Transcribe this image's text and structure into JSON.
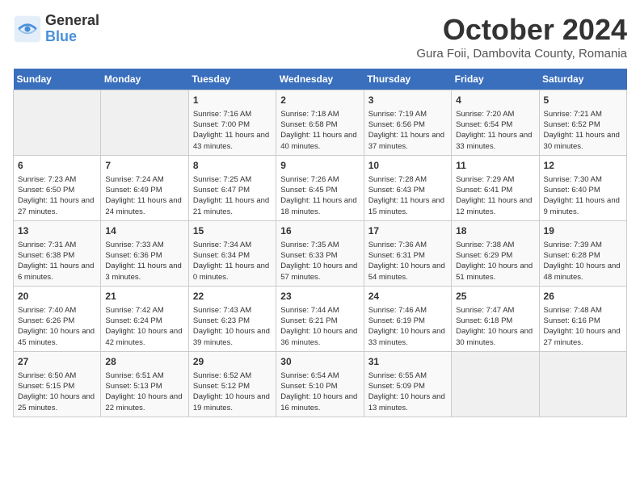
{
  "header": {
    "logo_line1": "General",
    "logo_line2": "Blue",
    "title": "October 2024",
    "subtitle": "Gura Foii, Dambovita County, Romania"
  },
  "weekdays": [
    "Sunday",
    "Monday",
    "Tuesday",
    "Wednesday",
    "Thursday",
    "Friday",
    "Saturday"
  ],
  "weeks": [
    [
      {
        "day": "",
        "info": ""
      },
      {
        "day": "",
        "info": ""
      },
      {
        "day": "1",
        "info": "Sunrise: 7:16 AM\nSunset: 7:00 PM\nDaylight: 11 hours and 43 minutes."
      },
      {
        "day": "2",
        "info": "Sunrise: 7:18 AM\nSunset: 6:58 PM\nDaylight: 11 hours and 40 minutes."
      },
      {
        "day": "3",
        "info": "Sunrise: 7:19 AM\nSunset: 6:56 PM\nDaylight: 11 hours and 37 minutes."
      },
      {
        "day": "4",
        "info": "Sunrise: 7:20 AM\nSunset: 6:54 PM\nDaylight: 11 hours and 33 minutes."
      },
      {
        "day": "5",
        "info": "Sunrise: 7:21 AM\nSunset: 6:52 PM\nDaylight: 11 hours and 30 minutes."
      }
    ],
    [
      {
        "day": "6",
        "info": "Sunrise: 7:23 AM\nSunset: 6:50 PM\nDaylight: 11 hours and 27 minutes."
      },
      {
        "day": "7",
        "info": "Sunrise: 7:24 AM\nSunset: 6:49 PM\nDaylight: 11 hours and 24 minutes."
      },
      {
        "day": "8",
        "info": "Sunrise: 7:25 AM\nSunset: 6:47 PM\nDaylight: 11 hours and 21 minutes."
      },
      {
        "day": "9",
        "info": "Sunrise: 7:26 AM\nSunset: 6:45 PM\nDaylight: 11 hours and 18 minutes."
      },
      {
        "day": "10",
        "info": "Sunrise: 7:28 AM\nSunset: 6:43 PM\nDaylight: 11 hours and 15 minutes."
      },
      {
        "day": "11",
        "info": "Sunrise: 7:29 AM\nSunset: 6:41 PM\nDaylight: 11 hours and 12 minutes."
      },
      {
        "day": "12",
        "info": "Sunrise: 7:30 AM\nSunset: 6:40 PM\nDaylight: 11 hours and 9 minutes."
      }
    ],
    [
      {
        "day": "13",
        "info": "Sunrise: 7:31 AM\nSunset: 6:38 PM\nDaylight: 11 hours and 6 minutes."
      },
      {
        "day": "14",
        "info": "Sunrise: 7:33 AM\nSunset: 6:36 PM\nDaylight: 11 hours and 3 minutes."
      },
      {
        "day": "15",
        "info": "Sunrise: 7:34 AM\nSunset: 6:34 PM\nDaylight: 11 hours and 0 minutes."
      },
      {
        "day": "16",
        "info": "Sunrise: 7:35 AM\nSunset: 6:33 PM\nDaylight: 10 hours and 57 minutes."
      },
      {
        "day": "17",
        "info": "Sunrise: 7:36 AM\nSunset: 6:31 PM\nDaylight: 10 hours and 54 minutes."
      },
      {
        "day": "18",
        "info": "Sunrise: 7:38 AM\nSunset: 6:29 PM\nDaylight: 10 hours and 51 minutes."
      },
      {
        "day": "19",
        "info": "Sunrise: 7:39 AM\nSunset: 6:28 PM\nDaylight: 10 hours and 48 minutes."
      }
    ],
    [
      {
        "day": "20",
        "info": "Sunrise: 7:40 AM\nSunset: 6:26 PM\nDaylight: 10 hours and 45 minutes."
      },
      {
        "day": "21",
        "info": "Sunrise: 7:42 AM\nSunset: 6:24 PM\nDaylight: 10 hours and 42 minutes."
      },
      {
        "day": "22",
        "info": "Sunrise: 7:43 AM\nSunset: 6:23 PM\nDaylight: 10 hours and 39 minutes."
      },
      {
        "day": "23",
        "info": "Sunrise: 7:44 AM\nSunset: 6:21 PM\nDaylight: 10 hours and 36 minutes."
      },
      {
        "day": "24",
        "info": "Sunrise: 7:46 AM\nSunset: 6:19 PM\nDaylight: 10 hours and 33 minutes."
      },
      {
        "day": "25",
        "info": "Sunrise: 7:47 AM\nSunset: 6:18 PM\nDaylight: 10 hours and 30 minutes."
      },
      {
        "day": "26",
        "info": "Sunrise: 7:48 AM\nSunset: 6:16 PM\nDaylight: 10 hours and 27 minutes."
      }
    ],
    [
      {
        "day": "27",
        "info": "Sunrise: 6:50 AM\nSunset: 5:15 PM\nDaylight: 10 hours and 25 minutes."
      },
      {
        "day": "28",
        "info": "Sunrise: 6:51 AM\nSunset: 5:13 PM\nDaylight: 10 hours and 22 minutes."
      },
      {
        "day": "29",
        "info": "Sunrise: 6:52 AM\nSunset: 5:12 PM\nDaylight: 10 hours and 19 minutes."
      },
      {
        "day": "30",
        "info": "Sunrise: 6:54 AM\nSunset: 5:10 PM\nDaylight: 10 hours and 16 minutes."
      },
      {
        "day": "31",
        "info": "Sunrise: 6:55 AM\nSunset: 5:09 PM\nDaylight: 10 hours and 13 minutes."
      },
      {
        "day": "",
        "info": ""
      },
      {
        "day": "",
        "info": ""
      }
    ]
  ]
}
